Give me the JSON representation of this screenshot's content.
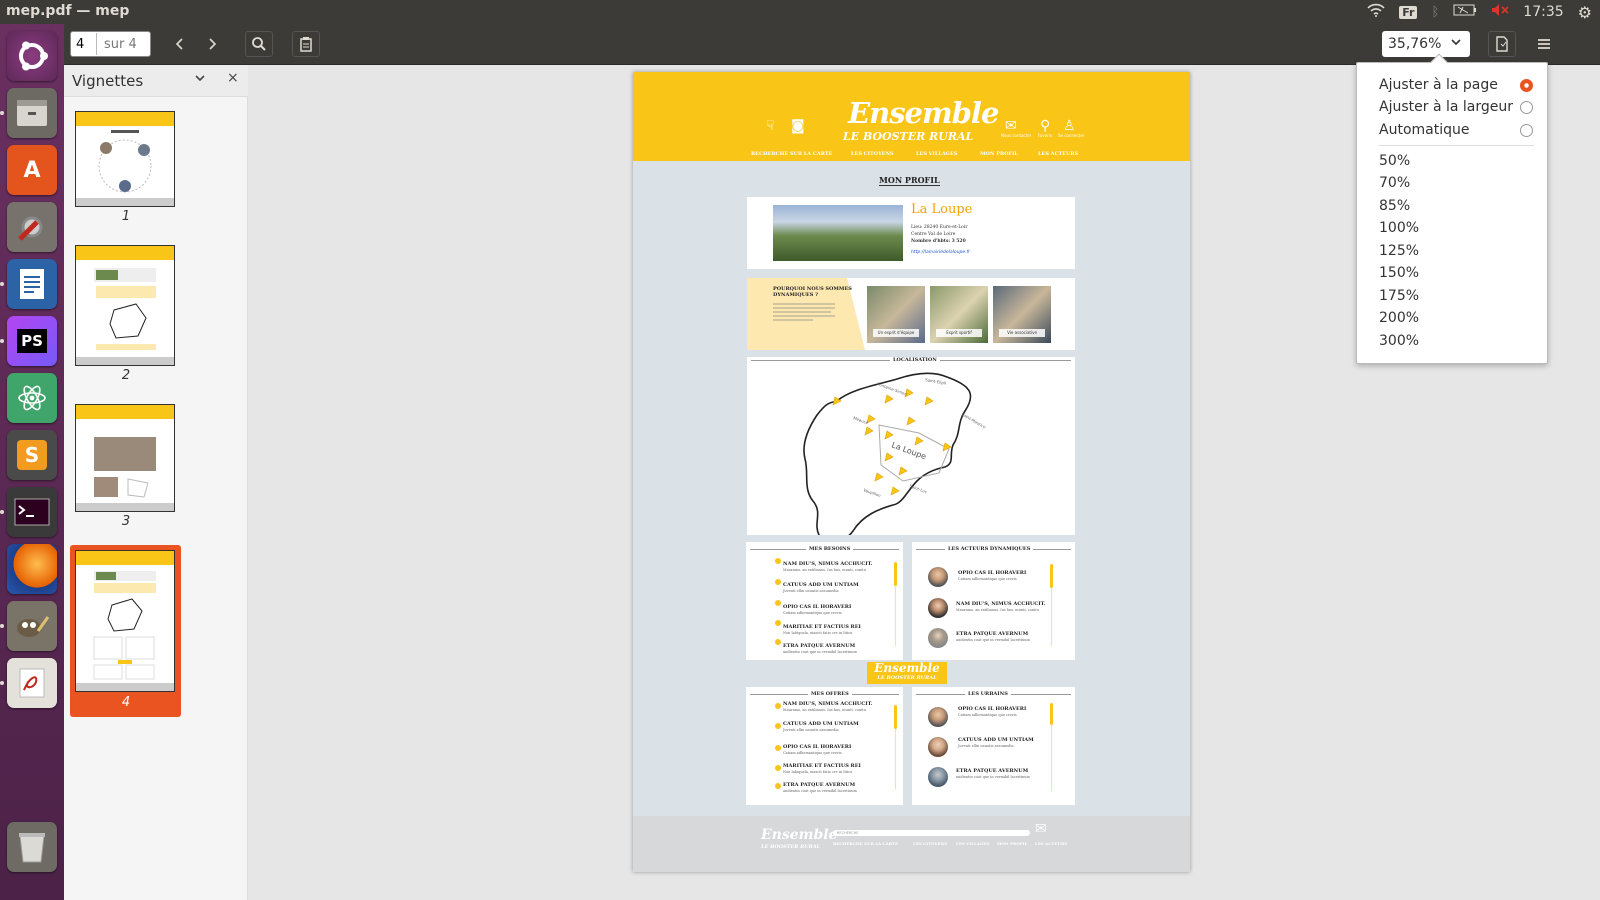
{
  "window": {
    "title": "mep.pdf — mep"
  },
  "tray": {
    "keyboard": "Fr",
    "clock": "17:35"
  },
  "toolbar": {
    "page_value": "4",
    "page_total": "sur 4",
    "zoom": "35,76%"
  },
  "sidebar": {
    "title": "Vignettes",
    "thumbs": [
      {
        "num": "1"
      },
      {
        "num": "2"
      },
      {
        "num": "3"
      },
      {
        "num": "4"
      }
    ]
  },
  "zoom_menu": {
    "fit_options": [
      "Ajuster à la page",
      "Ajuster à la largeur",
      "Automatique"
    ],
    "selected": "Ajuster à la page",
    "levels": [
      "50%",
      "70%",
      "85%",
      "100%",
      "125%",
      "150%",
      "175%",
      "200%",
      "300%"
    ]
  },
  "doc": {
    "logo": "Ensemble",
    "logo_sub": "LE BOOSTER RURAL",
    "nav": [
      "RECHERCHE SUR LA CARTE",
      "LES CITOYENS",
      "LES VILLAGES",
      "MON PROFIL",
      "LES ACTEURS"
    ],
    "header_icons": [
      "Nous contacter",
      "Favoris",
      "Se connecter"
    ],
    "section_title": "MON PROFIL",
    "village": {
      "name": "La Loupe",
      "lieu": "Lieu: 28240 Eure-et-Loir",
      "region": "Centre Val de Loire",
      "habitants": "Nombre d'hbts: 3 520",
      "url": "http://lamairiedelaloupe.fr"
    },
    "why_title": "POURQUOI NOUS SOMMES DYNAMIQUES ?",
    "why_photos": [
      "Un esprit d'équipe",
      "Esprit sportif",
      "Vie associative"
    ],
    "localisation": "LOCALISATION",
    "map_label": "La Loupe",
    "needs_title": "MES BESOINS",
    "actors_title": "LES ACTEURS DYNAMIQUES",
    "offers_title": "MES OFFRES",
    "urbains_title": "LES URBAINS",
    "needs": [
      {
        "t": "NAM DIU'S, NIMUS ACCHUCIT.",
        "d": "Mauramo, an extilianus. Ius hus, munti, conitu"
      },
      {
        "t": "CATUUS ADD UM UNTIAM",
        "d": "Juventi ellin ueuatis aesumedia"
      },
      {
        "t": "OPIO CAS IL HORAVERI",
        "d": "Catiam adhemantiquo que crevis"
      },
      {
        "t": "MARITIAE ET FACTIUS REI",
        "d": "Non labiquela, mascit fatio cre in liticu"
      },
      {
        "t": "ETRA PATQUE AVERNUM",
        "d": "andientin coat que in vermihil lacertinum"
      }
    ],
    "actors": [
      {
        "t": "OPIO CAS IL HORAVERI",
        "d": "Catiam adhemantiquo que crevis"
      },
      {
        "t": "NAM DIU'S, NIMUS ACCHUCIT.",
        "d": "Mauramo, an extilianus. Ius hus, munti, conitu"
      },
      {
        "t": "ETRA PATQUE AVERNUM",
        "d": "andientin coat que in vermihil lacertinum"
      }
    ],
    "urbains": [
      {
        "t": "OPIO CAS IL HORAVERI",
        "d": "Catiam adhemantiquo que crevis"
      },
      {
        "t": "CATUUS ADD UM UNTIAM",
        "d": "Juventi ellin ueuatis aesumedia"
      },
      {
        "t": "ETRA PATQUE AVERNUM",
        "d": "andientin coat que in vermihil lacertinum"
      }
    ],
    "footer_search": "RECHERCHE"
  },
  "colors": {
    "accent": "#e95420",
    "brand_yellow": "#f9c516",
    "toolbar": "#3c3b37"
  },
  "launcher_icons": [
    "ubuntu-icon",
    "files-icon",
    "software-center-icon",
    "system-settings-icon",
    "writer-icon",
    "phpstorm-icon",
    "atom-icon",
    "sublime-icon",
    "terminal-icon",
    "firefox-icon",
    "gimp-icon",
    "document-viewer-icon",
    "trash-icon"
  ]
}
